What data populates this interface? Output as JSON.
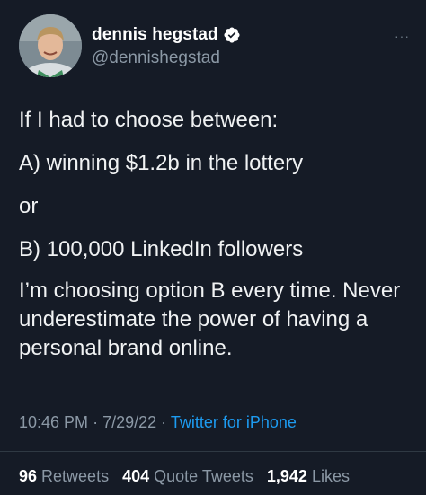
{
  "author": {
    "display_name": "dennis hegstad",
    "handle": "@dennishegstad",
    "verified_icon": "verified-badge-icon"
  },
  "more_icon": "···",
  "tweet": {
    "line1": "If I had to choose between:",
    "line2": "A) winning $1.2b in the lottery",
    "line3": "or",
    "line4": "B) 100,000 LinkedIn followers",
    "line5": "I’m choosing option B every time. Never underestimate the power of having a personal brand online."
  },
  "meta": {
    "time": "10:46 PM",
    "date": "7/29/22",
    "separator": "·",
    "source": "Twitter for iPhone"
  },
  "stats": {
    "retweets_count": "96",
    "retweets_label": "Retweets",
    "quotes_count": "404",
    "quotes_label": "Quote Tweets",
    "likes_count": "1,942",
    "likes_label": "Likes"
  },
  "colors": {
    "background": "#151b26",
    "accent": "#1d9bf0",
    "secondary_text": "#8b98a5"
  }
}
